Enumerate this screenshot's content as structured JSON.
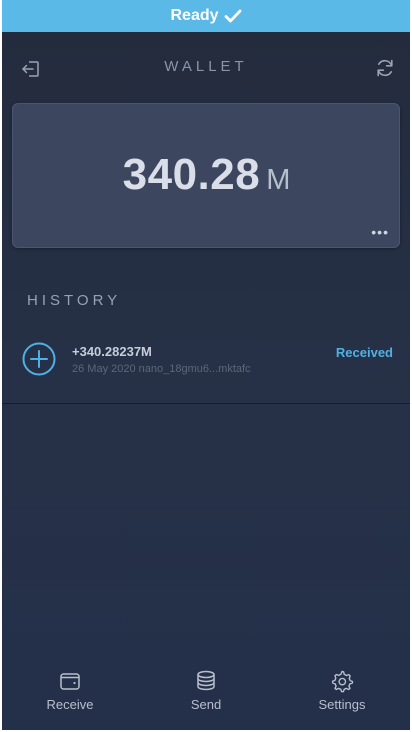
{
  "status_bar": {
    "label": "Ready",
    "icon": "check-icon",
    "color": "#5ab9e6"
  },
  "header": {
    "title": "WALLET",
    "left_icon": "logout-icon",
    "right_icon": "refresh-icon"
  },
  "balance": {
    "amount": "340.28",
    "unit": "M",
    "more_label": "•••"
  },
  "history": {
    "title": "HISTORY",
    "transactions": [
      {
        "icon": "plus-circle-icon",
        "amount": "+340.28237M",
        "meta": "26 May 2020 nano_18gmu6...mktafc",
        "status": "Received",
        "status_color": "#4fb2e4"
      }
    ]
  },
  "nav": {
    "items": [
      {
        "label": "Receive",
        "icon": "wallet-icon"
      },
      {
        "label": "Send",
        "icon": "coins-icon"
      },
      {
        "label": "Settings",
        "icon": "gear-icon"
      }
    ]
  }
}
